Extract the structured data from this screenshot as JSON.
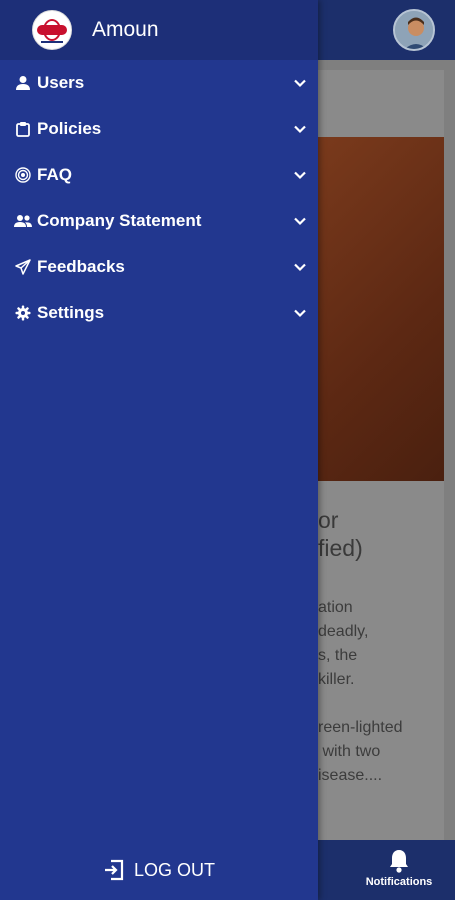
{
  "app": {
    "title": "Amoun"
  },
  "background": {
    "article_title": "or\nfied)",
    "article_body": "ation\ndeadly,\ns, the\nkiller.\n\nreen-lighted\n with two\nisease....",
    "notifications_label": "Notifications"
  },
  "menu": {
    "items": [
      {
        "label": "Users",
        "icon": "user-icon"
      },
      {
        "label": "Policies",
        "icon": "clipboard-icon"
      },
      {
        "label": "FAQ",
        "icon": "target-icon"
      },
      {
        "label": "Company Statement",
        "icon": "people-icon"
      },
      {
        "label": "Feedbacks",
        "icon": "paper-plane-icon"
      },
      {
        "label": "Settings",
        "icon": "gear-icon"
      }
    ]
  },
  "logout": {
    "label": "LOG OUT"
  },
  "colors": {
    "drawer": "#22378f",
    "header": "#1d2f78",
    "accent": "#c8102e"
  }
}
